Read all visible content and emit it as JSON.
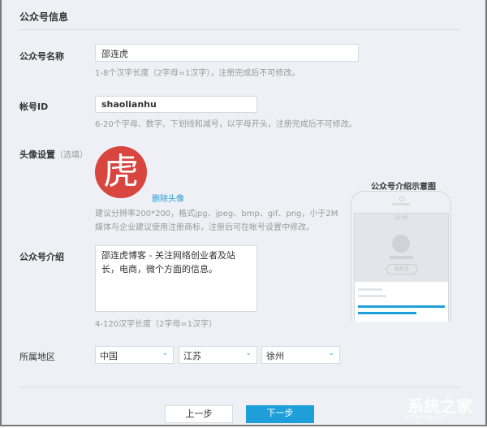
{
  "section_title": "公众号信息",
  "name": {
    "label": "公众号名称",
    "value": "邵连虎",
    "hint": "1-8个汉字长度（2字母=1汉字），注册完成后不可修改。"
  },
  "account_id": {
    "label": "帐号ID",
    "value": "shaolianhu",
    "hint": "6-20个字母、数字、下划线和减号，以字母开头，注册完成后不可修改。"
  },
  "avatar": {
    "label": "头像设置",
    "optional": "（选填）",
    "glyph": "虎",
    "delete_link": "删除头像",
    "hint1": "建议分辨率200*200，格式jpg、jpeg、bmp、gif、png，小于2M",
    "hint2": "媒体与企业建议使用注册商标，注册后可在帐号设置中修改。"
  },
  "intro": {
    "label": "公众号介绍",
    "value": "邵连虎博客 - 关注网络创业者及站长，电商，微个方面的信息。",
    "hint": "4-120汉字长度（2字母=1汉字）"
  },
  "preview": {
    "title": "公众号介绍示意图",
    "time": "12:00",
    "follow": "加关注"
  },
  "region": {
    "label": "所属地区",
    "country": "中国",
    "province": "江苏",
    "city": "徐州"
  },
  "buttons": {
    "prev": "上一步",
    "next": "下一步"
  },
  "watermark": {
    "text": "系统之家",
    "sub": "XITONGZHIJIA.NET"
  },
  "colors": {
    "accent": "#1e9fd9",
    "avatar_bg": "#d9453f"
  }
}
